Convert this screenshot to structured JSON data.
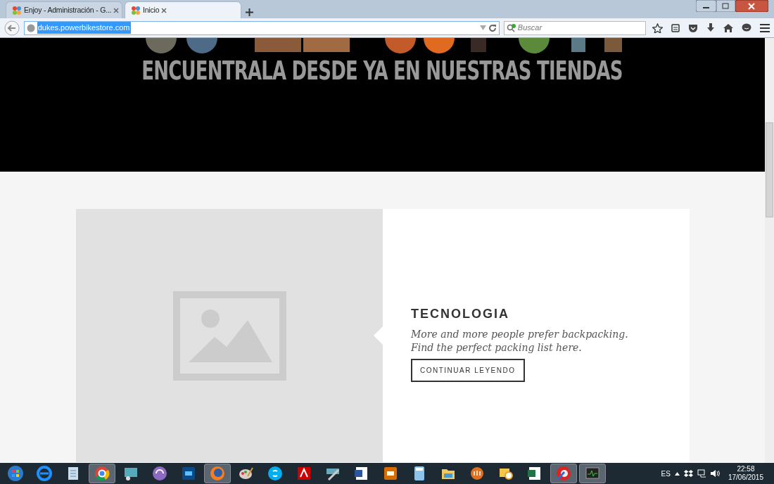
{
  "tabs": [
    {
      "label": "Enjoy - Administración - G...",
      "selected": false
    },
    {
      "label": "Inicio",
      "selected": true
    }
  ],
  "address_bar": {
    "value": "dukes.powerbikestore.com",
    "selected": true
  },
  "search": {
    "placeholder": "Buscar"
  },
  "banner": {
    "heading": "ENCUENTRALA DESDE YA EN NUESTRAS TIENDAS"
  },
  "feature": {
    "title": "TECNOLOGIA",
    "text": "More and more people prefer backpacking. Find the perfect packing list here.",
    "button": "CONTINUAR LEYENDO"
  },
  "taskbar": {
    "apps": [
      {
        "selected": false
      },
      {
        "selected": false
      },
      {
        "selected": true
      },
      {
        "selected": false
      },
      {
        "selected": false
      },
      {
        "selected": false
      },
      {
        "selected": true
      },
      {
        "selected": false
      },
      {
        "selected": false
      },
      {
        "selected": false
      },
      {
        "selected": false
      },
      {
        "selected": false
      },
      {
        "selected": false
      },
      {
        "selected": false
      },
      {
        "selected": false
      },
      {
        "selected": false
      },
      {
        "selected": false
      },
      {
        "selected": false
      },
      {
        "selected": true
      },
      {
        "selected": true
      }
    ],
    "language": "ES",
    "time": "22:58",
    "date": "17/06/2015"
  }
}
